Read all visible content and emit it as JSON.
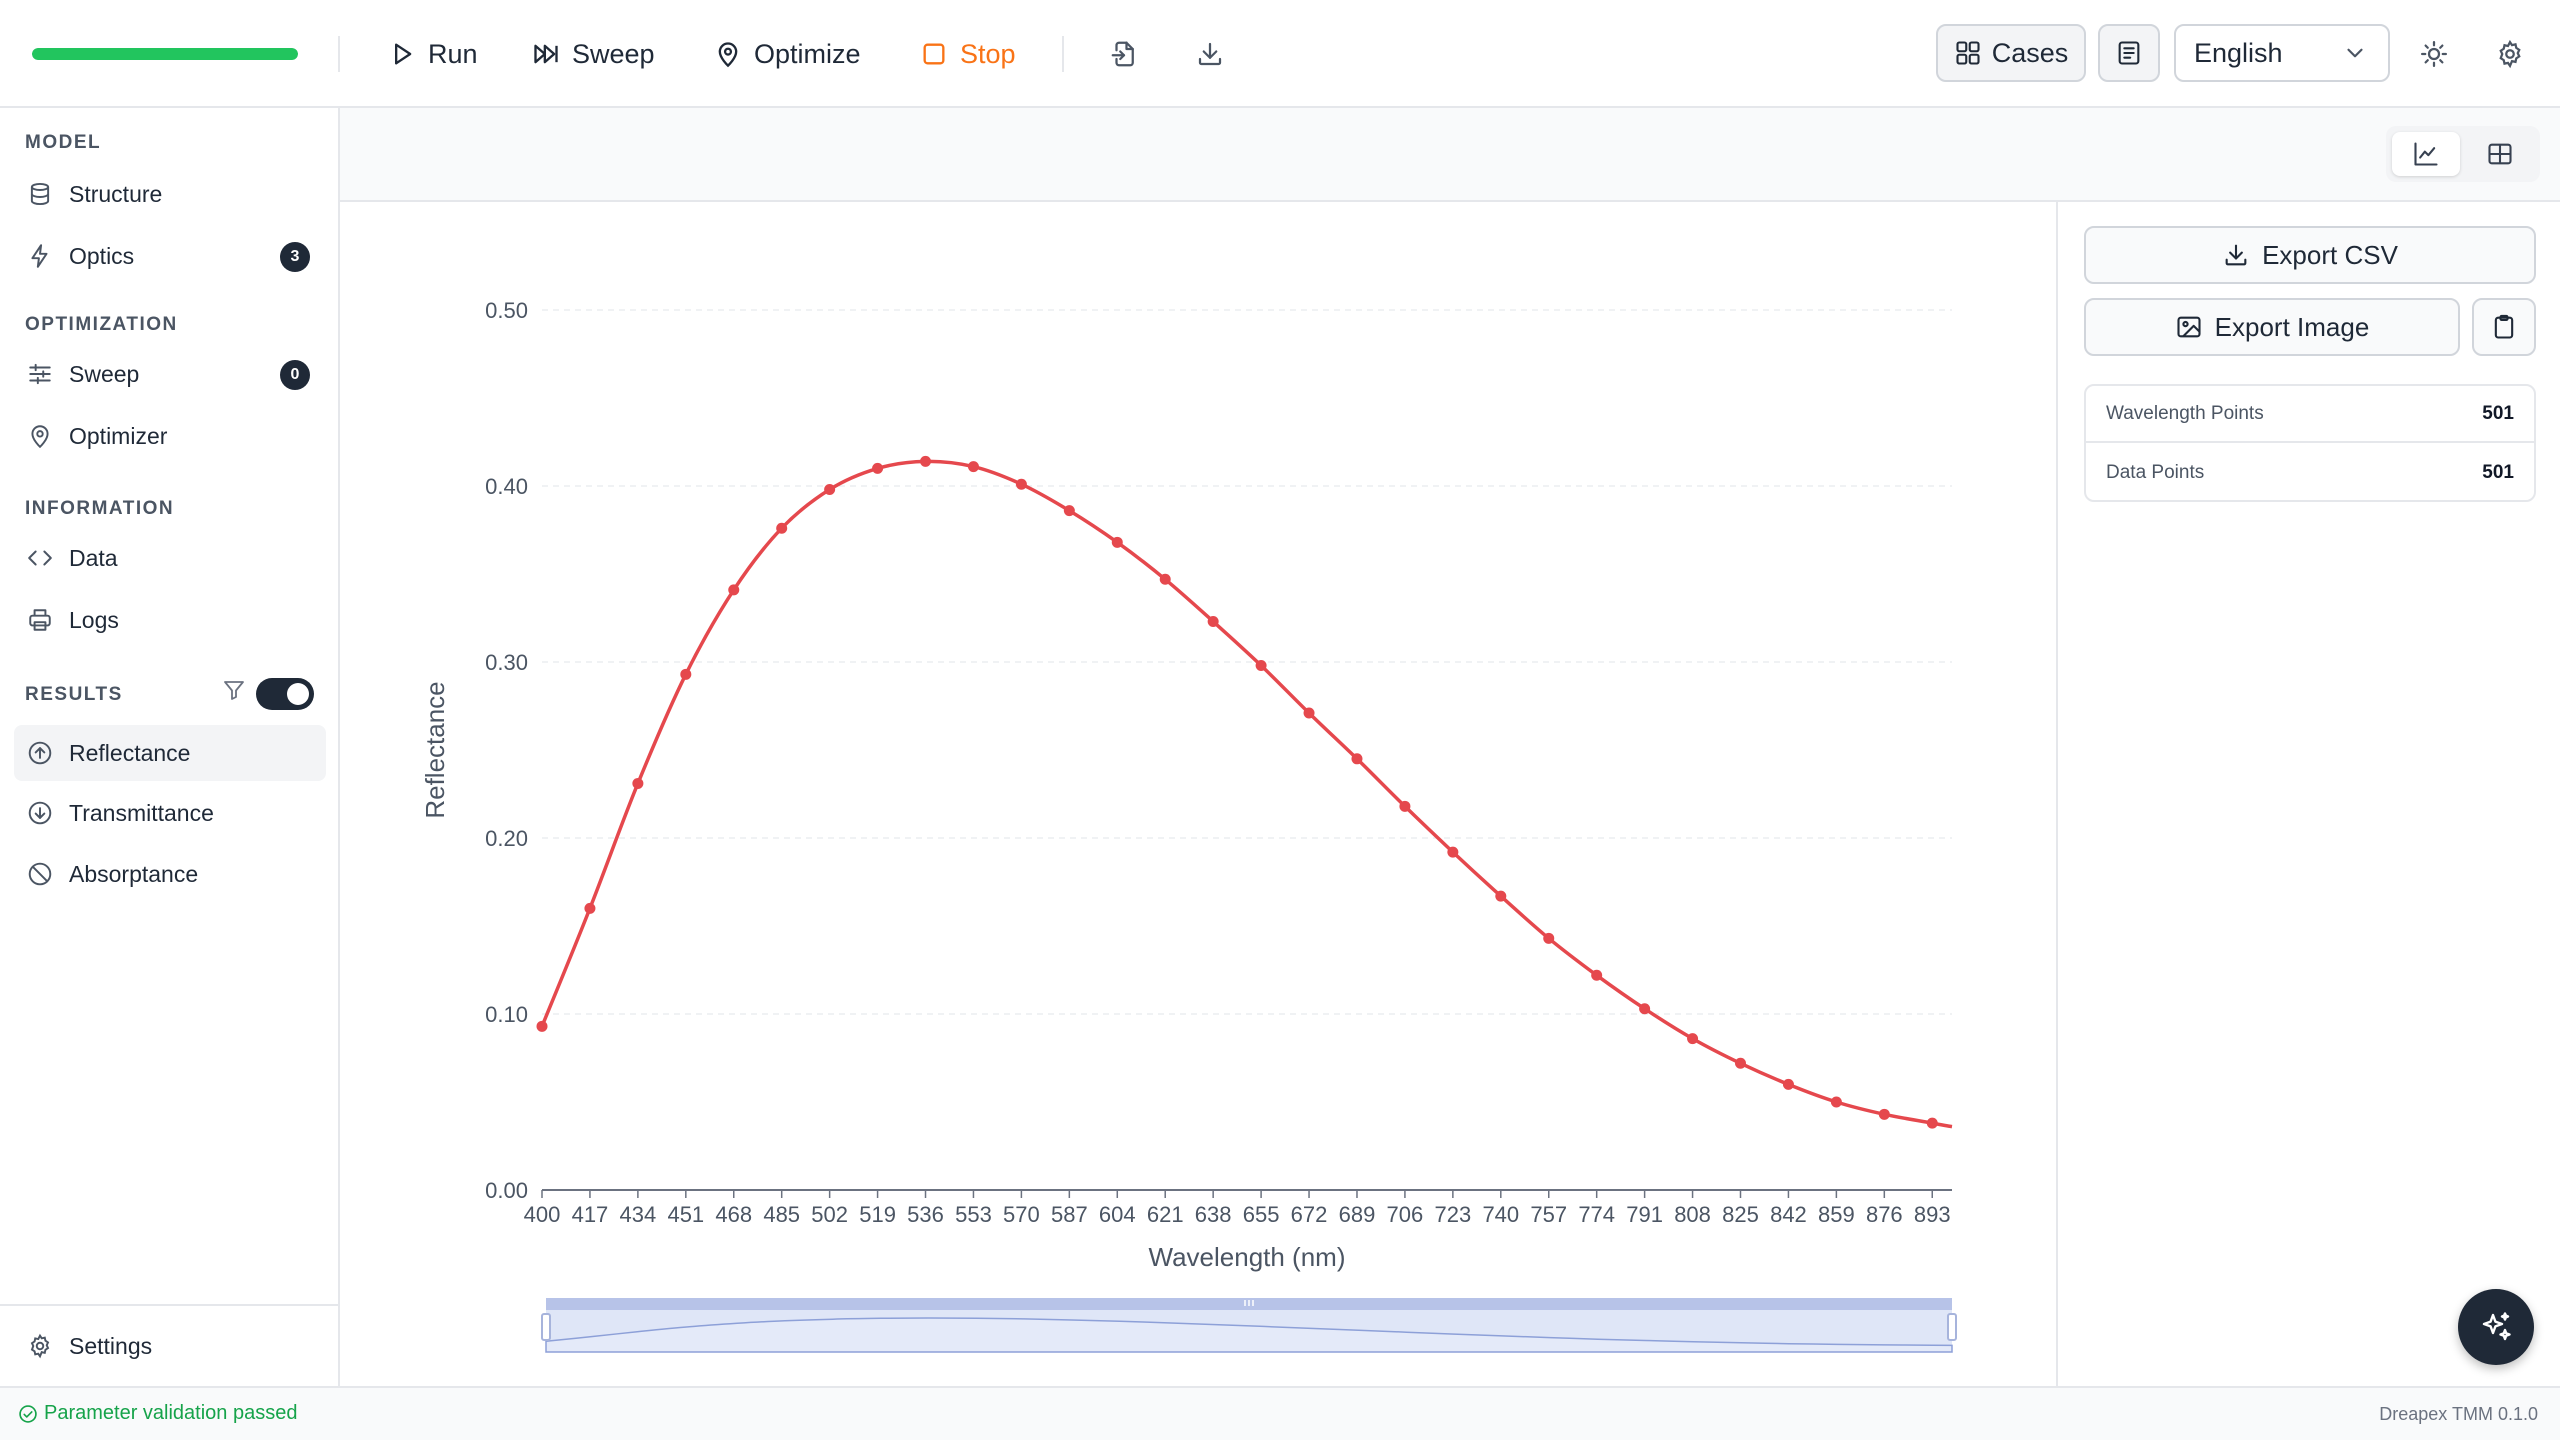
{
  "toolbar": {
    "progress": 1.0,
    "run_label": "Run",
    "sweep_label": "Sweep",
    "optimize_label": "Optimize",
    "stop_label": "Stop",
    "cases_label": "Cases",
    "language": "English"
  },
  "sidebar": {
    "model_label": "MODEL",
    "structure_label": "Structure",
    "optics_label": "Optics",
    "optics_badge": "3",
    "optimization_label": "OPTIMIZATION",
    "sweep_label": "Sweep",
    "sweep_badge": "0",
    "optimizer_label": "Optimizer",
    "information_label": "INFORMATION",
    "data_label": "Data",
    "logs_label": "Logs",
    "results_label": "RESULTS",
    "results_toggle_on": true,
    "reflectance_label": "Reflectance",
    "transmittance_label": "Transmittance",
    "absorptance_label": "Absorptance",
    "settings_label": "Settings"
  },
  "panel": {
    "export_csv_label": "Export CSV",
    "export_image_label": "Export Image",
    "stats": [
      {
        "key": "Wavelength Points",
        "value": "501"
      },
      {
        "key": "Data Points",
        "value": "501"
      }
    ]
  },
  "status": {
    "message": "Parameter validation passed",
    "version": "Dreapex TMM 0.1.0"
  },
  "colors": {
    "accent": "#1f2937",
    "progress": "#22c55e",
    "stop": "#f97316",
    "series": "#e5484d",
    "ok": "#16a34a"
  },
  "chart_data": {
    "type": "line",
    "xlabel": "Wavelength (nm)",
    "ylabel": "Reflectance",
    "xlim": [
      400,
      900
    ],
    "ylim": [
      0,
      0.5
    ],
    "yticks": [
      0.0,
      0.1,
      0.2,
      0.3,
      0.4,
      0.5
    ],
    "ytick_labels": [
      "0.00",
      "0.10",
      "0.20",
      "0.30",
      "0.40",
      "0.50"
    ],
    "xtick_labels": [
      "400",
      "417",
      "434",
      "451",
      "468",
      "485",
      "502",
      "519",
      "536",
      "553",
      "570",
      "587",
      "604",
      "621",
      "638",
      "655",
      "672",
      "689",
      "706",
      "723",
      "740",
      "757",
      "774",
      "791",
      "808",
      "825",
      "842",
      "859",
      "876",
      "893"
    ],
    "grid": true,
    "data_zoom": true,
    "series": [
      {
        "x": [
          400,
          417,
          434,
          451,
          468,
          485,
          502,
          519,
          536,
          553,
          570,
          587,
          604,
          621,
          638,
          655,
          672,
          689,
          706,
          723,
          740,
          757,
          774,
          791,
          808,
          825,
          842,
          859,
          876,
          893,
          900
        ],
        "y": [
          0.093,
          0.16,
          0.231,
          0.293,
          0.341,
          0.376,
          0.398,
          0.41,
          0.414,
          0.411,
          0.401,
          0.386,
          0.368,
          0.347,
          0.323,
          0.298,
          0.271,
          0.245,
          0.218,
          0.192,
          0.167,
          0.143,
          0.122,
          0.103,
          0.086,
          0.072,
          0.06,
          0.05,
          0.043,
          0.038,
          0.036
        ]
      }
    ]
  }
}
